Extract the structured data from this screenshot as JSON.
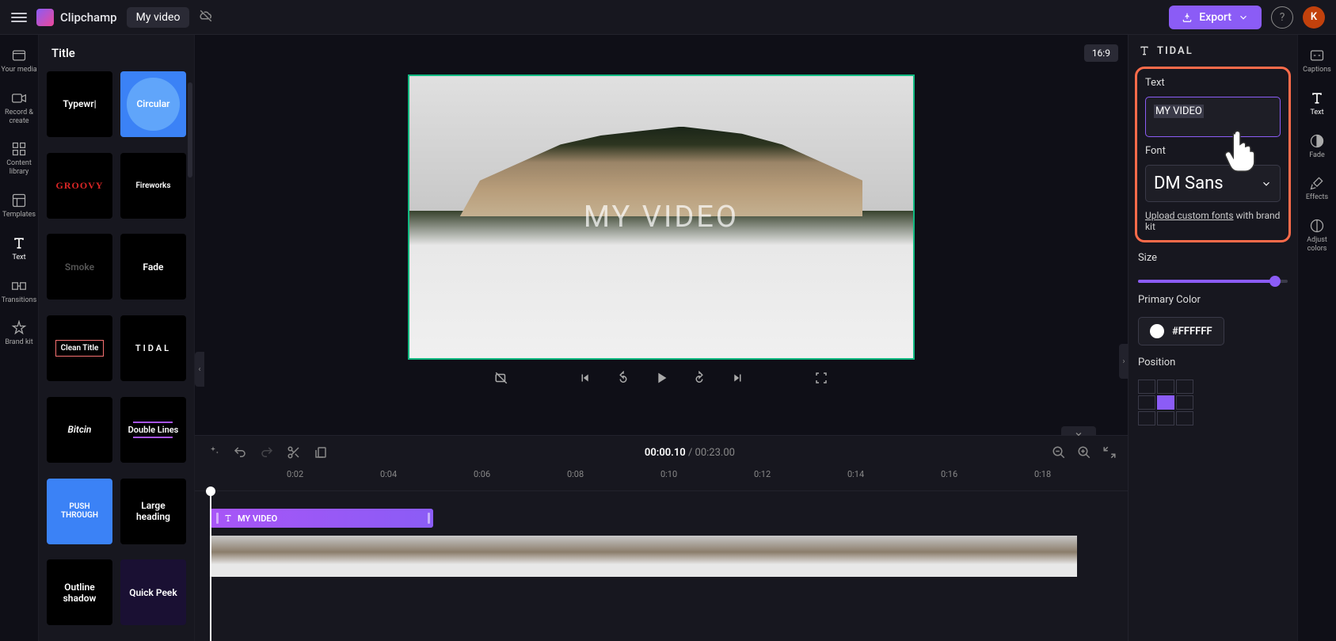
{
  "app": {
    "name": "Clipchamp",
    "project": "My video"
  },
  "topbar": {
    "export": "Export",
    "avatar": "K"
  },
  "iconbar": [
    {
      "label": "Your media"
    },
    {
      "label": "Record & create"
    },
    {
      "label": "Content library"
    },
    {
      "label": "Templates"
    },
    {
      "label": "Text"
    },
    {
      "label": "Transitions"
    },
    {
      "label": "Brand kit"
    }
  ],
  "titlesPanel": {
    "header": "Title",
    "items": [
      "Typewr|",
      "Circular",
      "GROOVY",
      "Fireworks",
      "Smoke",
      "Fade",
      "Clean Title",
      "TIDAL",
      "Bitcin",
      "Double Lines",
      "PUSH THROUGH",
      "Large heading",
      "Outline shadow",
      "Quick Peek"
    ]
  },
  "preview": {
    "aspect": "16:9",
    "overlayText": "MY VIDEO"
  },
  "timeline": {
    "current": "00:00.10",
    "total": "00:23.00",
    "ticks": [
      "0:02",
      "0:04",
      "0:06",
      "0:08",
      "0:10",
      "0:12",
      "0:14",
      "0:16",
      "0:18"
    ],
    "textClip": "MY VIDEO"
  },
  "rightPanel": {
    "header": "TIDAL",
    "textLabel": "Text",
    "textValue": "MY VIDEO",
    "fontLabel": "Font",
    "fontValue": "DM Sans",
    "uploadLink": "Upload custom fonts",
    "uploadSuffix": " with brand kit",
    "sizeLabel": "Size",
    "colorLabel": "Primary Color",
    "colorValue": "#FFFFFF",
    "positionLabel": "Position"
  },
  "rightIconbar": [
    {
      "label": "Captions"
    },
    {
      "label": "Text"
    },
    {
      "label": "Fade"
    },
    {
      "label": "Effects"
    },
    {
      "label": "Adjust colors"
    }
  ]
}
